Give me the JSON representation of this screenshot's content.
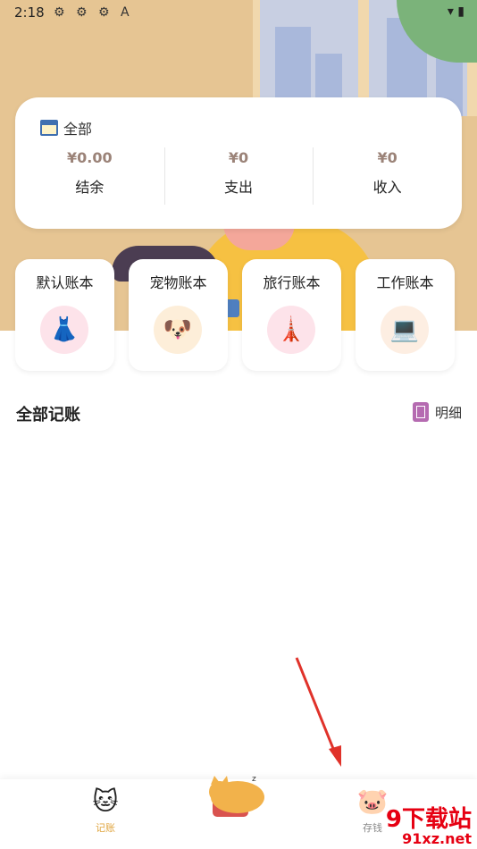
{
  "status_bar": {
    "time": "2:18",
    "notif_icons": "⚙ ⚙ ⚙ A",
    "sys_icons": "▾ ▮"
  },
  "summary": {
    "title": "全部",
    "columns": [
      {
        "value": "¥0.00",
        "label": "结余"
      },
      {
        "value": "¥0",
        "label": "支出"
      },
      {
        "value": "¥0",
        "label": "收入"
      }
    ]
  },
  "books": [
    {
      "label": "默认账本",
      "icon": "👗",
      "icon_name": "dress-icon",
      "bg": "#fde3ea"
    },
    {
      "label": "宠物账本",
      "icon": "🐶",
      "icon_name": "dog-icon",
      "bg": "#fdeed9"
    },
    {
      "label": "旅行账本",
      "icon": "🗼",
      "icon_name": "lighthouse-icon",
      "bg": "#fde3ea"
    },
    {
      "label": "工作账本",
      "icon": "💻",
      "icon_name": "worker-laptop-icon",
      "bg": "#fdeee2"
    }
  ],
  "section": {
    "title": "全部记账",
    "detail_label": "明细"
  },
  "bottom_nav": {
    "left_label": "记账",
    "right_label": "存钱",
    "left_icon": "🐱",
    "center_icon": "😺",
    "right_icon": "🐷"
  },
  "watermark": {
    "main": "9下载站",
    "sub": "91xz.net"
  },
  "colors": {
    "accent": "#e0a641",
    "amount": "#9b8378",
    "hero": "#e6c593"
  }
}
